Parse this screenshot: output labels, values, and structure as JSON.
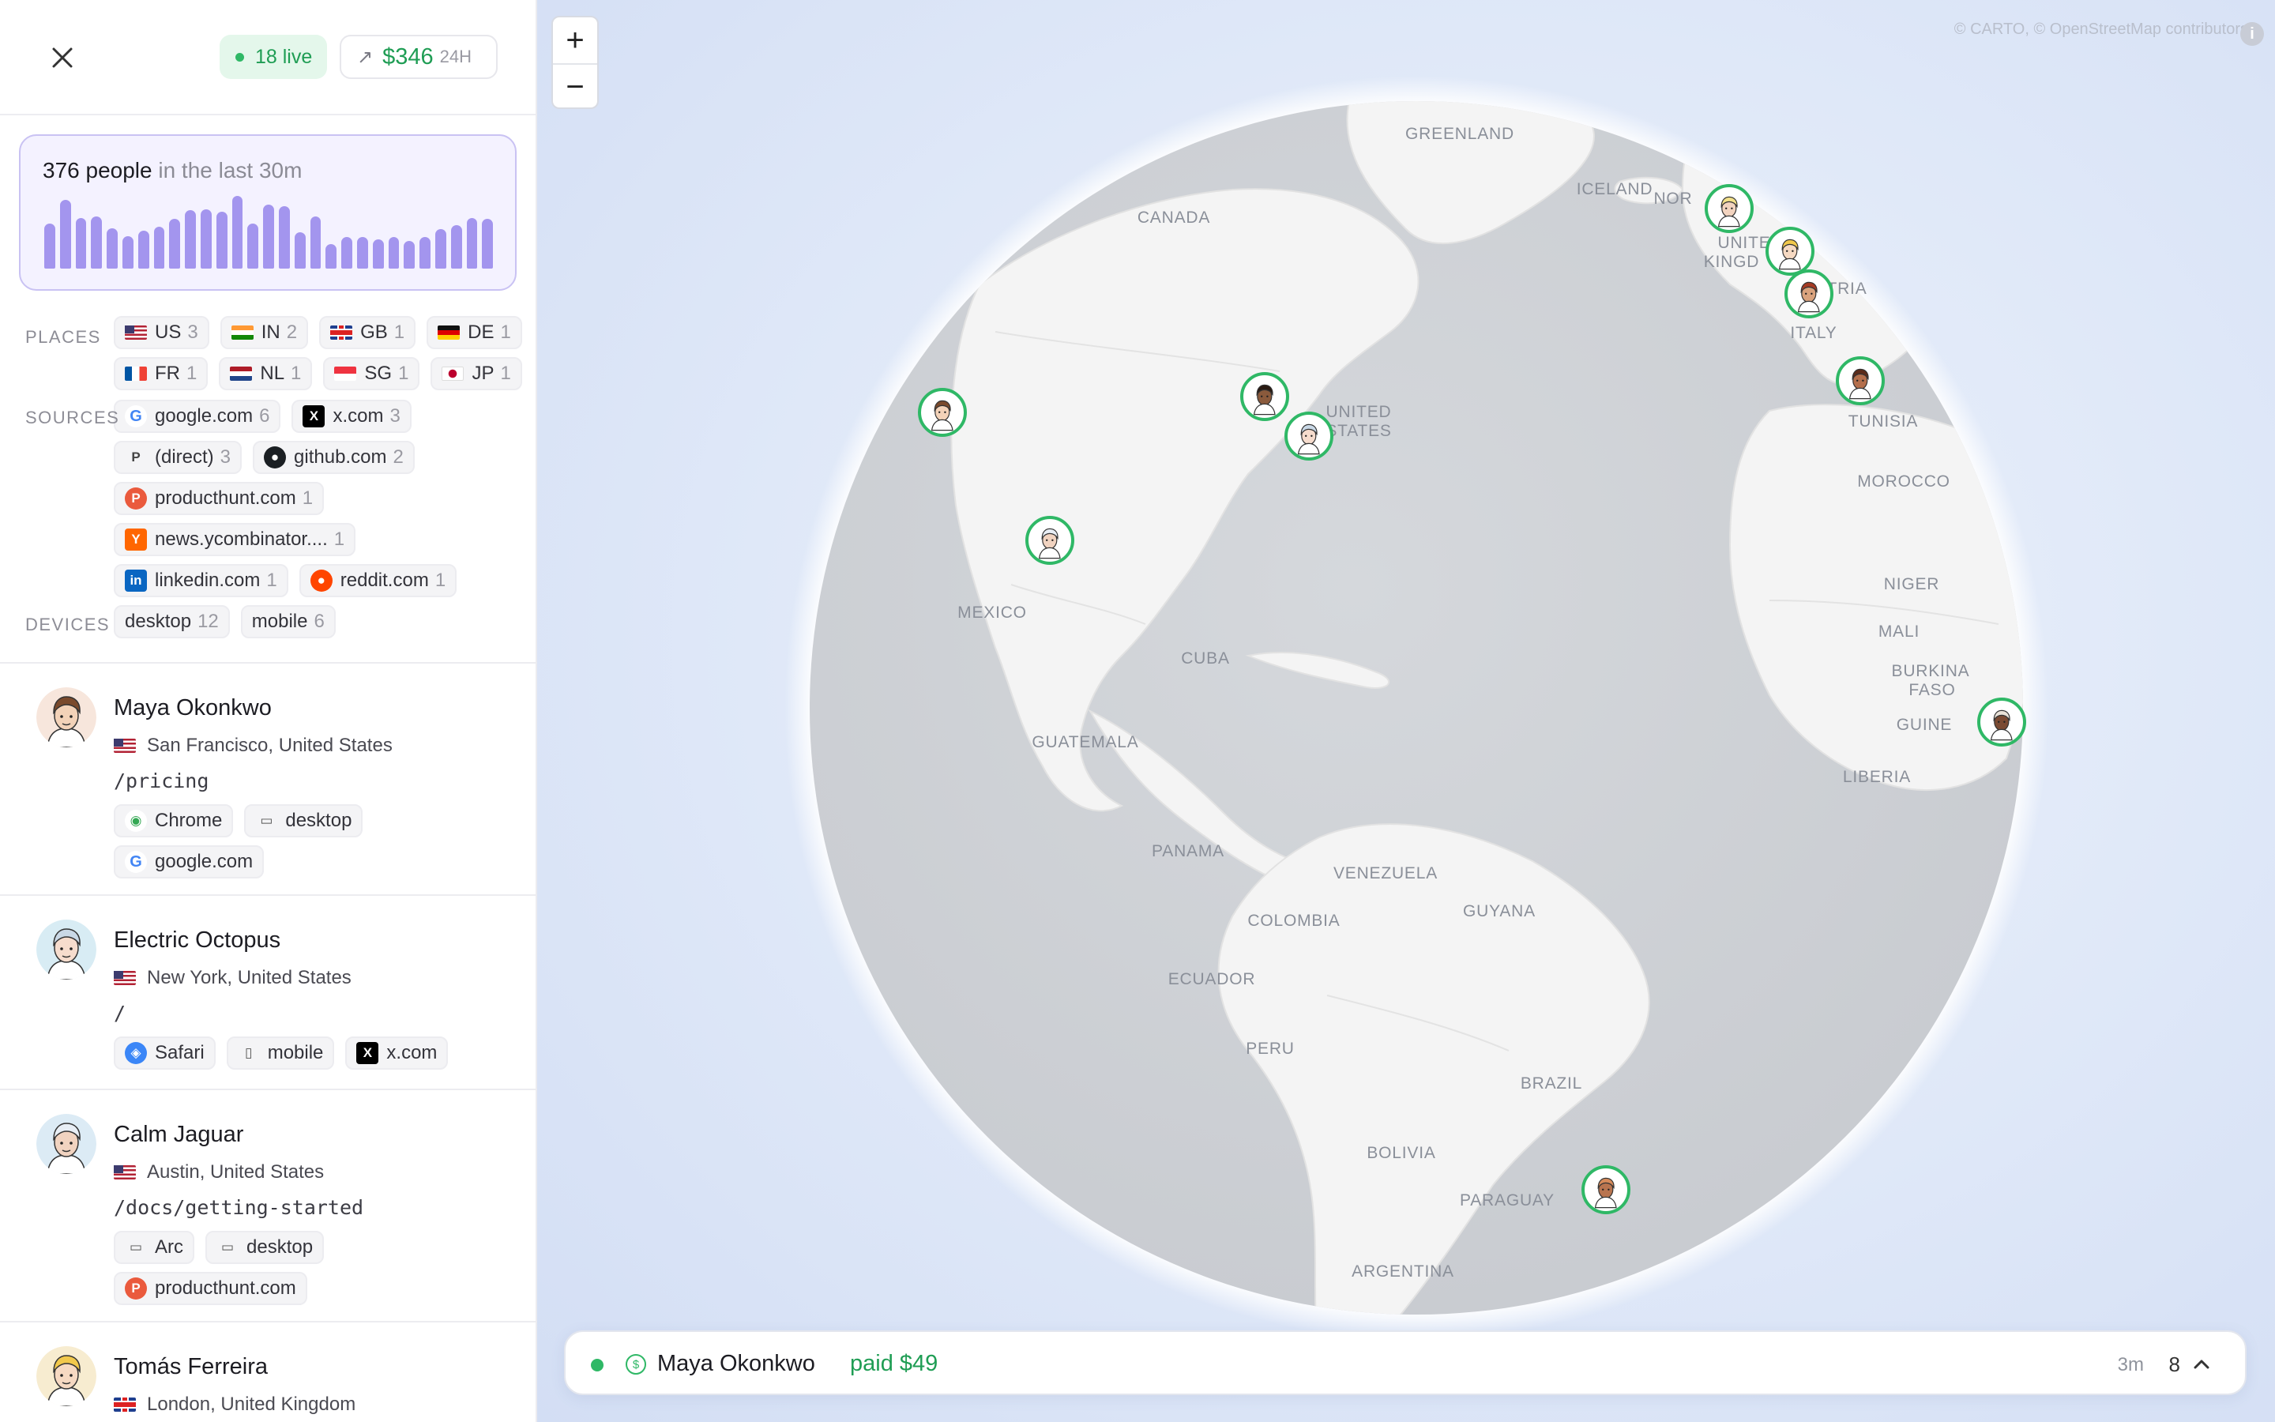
{
  "header": {
    "live_label": "18 live",
    "revenue_amount": "$346",
    "revenue_period": "24H"
  },
  "traffic": {
    "count": "376 people",
    "window": "in the last 30m",
    "bar_heights": [
      0.62,
      0.95,
      0.7,
      0.72,
      0.55,
      0.45,
      0.52,
      0.58,
      0.68,
      0.8,
      0.82,
      0.78,
      1.0,
      0.62,
      0.88,
      0.86,
      0.5,
      0.72,
      0.34,
      0.44,
      0.43,
      0.4,
      0.44,
      0.38,
      0.44,
      0.54,
      0.6,
      0.7,
      0.68
    ]
  },
  "filters": {
    "places_label": "PLACES",
    "places": [
      {
        "flag": "us",
        "code": "US",
        "count": "3"
      },
      {
        "flag": "in",
        "code": "IN",
        "count": "2"
      },
      {
        "flag": "gb",
        "code": "GB",
        "count": "1"
      },
      {
        "flag": "de",
        "code": "DE",
        "count": "1"
      },
      {
        "flag": "fr",
        "code": "FR",
        "count": "1"
      },
      {
        "flag": "nl",
        "code": "NL",
        "count": "1"
      },
      {
        "flag": "sg",
        "code": "SG",
        "count": "1"
      },
      {
        "flag": "jp",
        "code": "JP",
        "count": "1"
      }
    ],
    "sources_label": "SOURCES",
    "sources": [
      {
        "icon": "google-icon",
        "name": "google.com",
        "count": "6"
      },
      {
        "icon": "x-icon",
        "name": "x.com",
        "count": "3"
      },
      {
        "icon": "direct-icon",
        "name": "(direct)",
        "count": "3"
      },
      {
        "icon": "github-icon",
        "name": "github.com",
        "count": "2"
      },
      {
        "icon": "producthunt-icon",
        "name": "producthunt.com",
        "count": "1"
      },
      {
        "icon": "ycombinator-icon",
        "name": "news.ycombinator....",
        "count": "1"
      },
      {
        "icon": "linkedin-icon",
        "name": "linkedin.com",
        "count": "1"
      },
      {
        "icon": "reddit-icon",
        "name": "reddit.com",
        "count": "1"
      }
    ],
    "devices_label": "DEVICES",
    "devices": [
      {
        "name": "desktop",
        "count": "12"
      },
      {
        "name": "mobile",
        "count": "6"
      }
    ]
  },
  "visitors": [
    {
      "name": "Maya Okonkwo",
      "flag": "us",
      "location": "San Francisco, United States",
      "path": "/pricing",
      "browser": "Chrome",
      "browser_icon": "chrome-icon",
      "device": "desktop",
      "device_icon": "desktop-icon",
      "source": "google.com",
      "source_icon": "google-icon",
      "skin": "#f3d2b8",
      "hair": "#7a4a2c",
      "bg": "#f7e6dc"
    },
    {
      "name": "Electric Octopus",
      "flag": "us",
      "location": "New York, United States",
      "path": "/",
      "browser": "Safari",
      "browser_icon": "safari-icon",
      "device": "mobile",
      "device_icon": "mobile-icon",
      "source": "x.com",
      "source_icon": "x-icon",
      "skin": "#f6dccd",
      "hair": "#c9d8e6",
      "bg": "#d8ecf4"
    },
    {
      "name": "Calm Jaguar",
      "flag": "us",
      "location": "Austin, United States",
      "path": "/docs/getting-started",
      "browser": "Arc",
      "browser_icon": "arc-icon",
      "device": "desktop",
      "device_icon": "desktop-icon",
      "source": "producthunt.com",
      "source_icon": "producthunt-icon",
      "skin": "#f1d3c0",
      "hair": "#e8eef5",
      "bg": "#dcebf5"
    },
    {
      "name": "Tomás Ferreira",
      "flag": "gb",
      "location": "London, United Kingdom",
      "path": "",
      "browser": "",
      "browser_icon": "",
      "device": "",
      "device_icon": "",
      "source": "",
      "source_icon": "",
      "skin": "#f6d9c2",
      "hair": "#f1c84c",
      "bg": "#f7ecd0"
    }
  ],
  "map": {
    "attribution": "© CARTO, © OpenStreetMap contributors",
    "zoom_in": "+",
    "zoom_out": "−",
    "labels": [
      {
        "text": "GREENLAND"
      },
      {
        "text": "ICELAND"
      },
      {
        "text": "NOR"
      },
      {
        "text": "CANADA"
      },
      {
        "text": "UNITE"
      },
      {
        "text": "KINGD"
      },
      {
        "text": "TRIA"
      },
      {
        "text": "ITALY"
      },
      {
        "text": "UNITED"
      },
      {
        "text": "STATES"
      },
      {
        "text": "TUNISIA"
      },
      {
        "text": "MOROCCO"
      },
      {
        "text": "NIGER"
      },
      {
        "text": "MALI"
      },
      {
        "text": "MEXICO"
      },
      {
        "text": "CUBA"
      },
      {
        "text": "BURKINA"
      },
      {
        "text": "FASO"
      },
      {
        "text": "GUINE"
      },
      {
        "text": "LIBERIA"
      },
      {
        "text": "GUATEMALA"
      },
      {
        "text": "PANAMA"
      },
      {
        "text": "VENEZUELA"
      },
      {
        "text": "GUYANA"
      },
      {
        "text": "COLOMBIA"
      },
      {
        "text": "ECUADOR"
      },
      {
        "text": "PERU"
      },
      {
        "text": "BRAZIL"
      },
      {
        "text": "BOLIVIA"
      },
      {
        "text": "PARAGUAY"
      },
      {
        "text": "ARGENTINA"
      }
    ],
    "markers": [
      {
        "name": "Maya Okonkwo",
        "skin": "#f3d2b8",
        "hair": "#7a4a2c"
      },
      {
        "name": "Electric Octopus",
        "skin": "#f6dccd",
        "hair": "#c9d8e6"
      },
      {
        "name": "Calm Jaguar",
        "skin": "#f1d3c0",
        "hair": "#e8eef5"
      },
      {
        "name": "visitor-chicago",
        "skin": "#8a5a3c",
        "hair": "#2a1a12"
      },
      {
        "name": "visitor-norway",
        "skin": "#f2d3bf",
        "hair": "#f3e08a"
      },
      {
        "name": "Tomás Ferreira",
        "skin": "#f6d9c2",
        "hair": "#f1c84c"
      },
      {
        "name": "visitor-europe-2",
        "skin": "#d9a27d",
        "hair": "#a53a23"
      },
      {
        "name": "visitor-italy",
        "skin": "#b46f4c",
        "hair": "#5b2b1a"
      },
      {
        "name": "visitor-west-africa",
        "skin": "#7a4a32",
        "hair": "#e9e2d8"
      },
      {
        "name": "visitor-south-brazil",
        "skin": "#b8744f",
        "hair": "#d68a5a"
      }
    ]
  },
  "ticker": {
    "name": "Maya Okonkwo",
    "action": "paid $49",
    "ago": "3m",
    "count": "8",
    "coin_symbol": "$"
  },
  "colors": {
    "accent_green": "#1f9d54",
    "bar_purple": "#a395ee",
    "panel_border": "#c9c2f3"
  }
}
